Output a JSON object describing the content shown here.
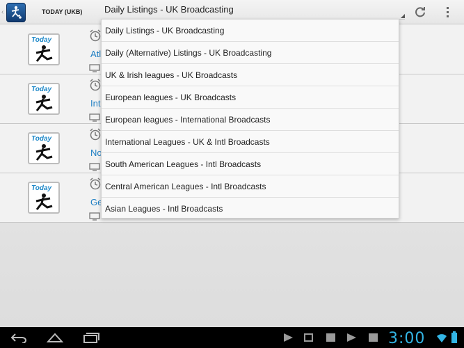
{
  "actionbar": {
    "title": "TODAY (UKB)",
    "selected_listing": "Daily Listings - UK Broadcasting"
  },
  "dropdown": {
    "items": [
      "Daily Listings - UK Broadcasting",
      "Daily (Alternative) Listings - UK Broadcasting",
      "UK & Irish leagues - UK Broadcasts",
      "European leagues - UK Broadcasts",
      "European leagues - International Broadcasts",
      "International Leagues - UK & Intl Broadcasts",
      "South American Leagues - Intl Broadcasts",
      "Central American Leagues - Intl Broadcasts",
      "Asian Leagues - Intl Broadcasts"
    ]
  },
  "list": {
    "rows": [
      {
        "title_fragment": "Atl",
        "badge": "Today"
      },
      {
        "title_fragment": "Int",
        "badge": "Today"
      },
      {
        "title_fragment": "No",
        "badge": "Today"
      },
      {
        "title_fragment": "Ge",
        "badge": "Today"
      }
    ]
  },
  "systembar": {
    "clock": "3:00"
  },
  "colors": {
    "accent": "#33b5e5",
    "link": "#1e7fc4"
  }
}
